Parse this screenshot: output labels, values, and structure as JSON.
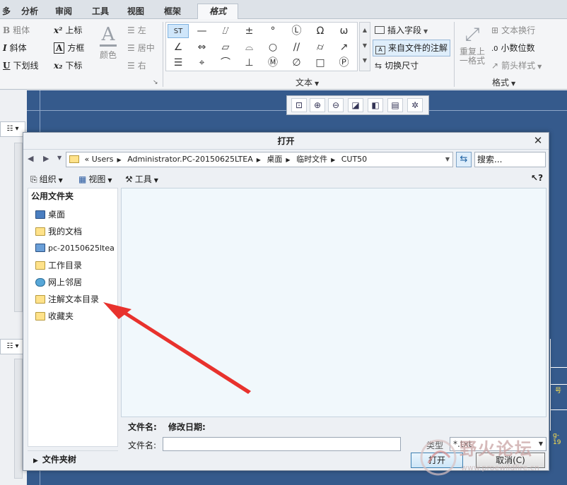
{
  "tabs": [
    {
      "label": "多"
    },
    {
      "label": "分析"
    },
    {
      "label": "审阅"
    },
    {
      "label": "工具"
    },
    {
      "label": "视图"
    },
    {
      "label": "框架"
    },
    {
      "label": "格式"
    }
  ],
  "ribbon": {
    "font_group": {
      "bold": "粗体",
      "italic": "斜体",
      "underline": "下划线",
      "superscript": "上标",
      "box": "方框",
      "subscript": "下标",
      "color": "颜色"
    },
    "align_group": {
      "left": "左",
      "center": "居中",
      "right": "右"
    },
    "text_group": {
      "symbols": [
        "ST",
        "—",
        "⌰",
        "±",
        "°",
        "Ⓛ",
        "Ω",
        "ω",
        "∠",
        "⇔",
        "▱",
        "⌓",
        "○",
        "//",
        "⌭",
        "↗",
        "☰",
        "⌖",
        "⌒",
        "⊥",
        "Ⓜ",
        "∅",
        "□",
        "Ⓟ"
      ],
      "insert_field": "插入字段",
      "from_file": "来自文件的注解",
      "toggle_dimension": "切换尺寸",
      "label": "文本"
    },
    "format_group": {
      "repeat_format": "重复上一格式",
      "text_wrap": "文本换行",
      "decimal_places": "小数位数",
      "arrow_style": "箭头样式",
      "label": "格式"
    }
  },
  "mini_toolbar": {
    "icons": [
      "zoom-fit",
      "zoom-in",
      "zoom-out",
      "refit",
      "view-orientation",
      "layer",
      "repaint"
    ]
  },
  "dialog": {
    "title": "打开",
    "address": {
      "path": [
        "Users",
        "Administrator.PC-20150625LTEA",
        "桌面",
        "临时文件",
        "CUT50"
      ],
      "prefix": "«"
    },
    "search_placeholder": "搜索...",
    "toolbar": {
      "organize": "组织",
      "views": "视图",
      "tools": "工具",
      "help": "?"
    },
    "nav": {
      "header": "公用文件夹",
      "items": [
        {
          "label": "桌面"
        },
        {
          "label": "我的文档"
        },
        {
          "label": "pc-20150625ltea"
        },
        {
          "label": "工作目录"
        },
        {
          "label": "网上邻居"
        },
        {
          "label": "注解文本目录"
        },
        {
          "label": "收藏夹"
        }
      ],
      "folder_tree": "文件夹树"
    },
    "columns": {
      "name": "文件名:",
      "modified": "修改日期:"
    },
    "filename_label": "文件名:",
    "filename_value": "",
    "type_label": "类型",
    "type_value": "*.txt",
    "open_button": "打开",
    "cancel_button": "取消(C)"
  },
  "drawing": {
    "labels": [
      "号",
      "g-19"
    ]
  },
  "watermark": {
    "text": "野火论坛",
    "url": "www.proewildfire.cn"
  },
  "colors": {
    "canvas": "#355a8c",
    "accent": "#e8322d",
    "selected": "#cfe6fa"
  }
}
